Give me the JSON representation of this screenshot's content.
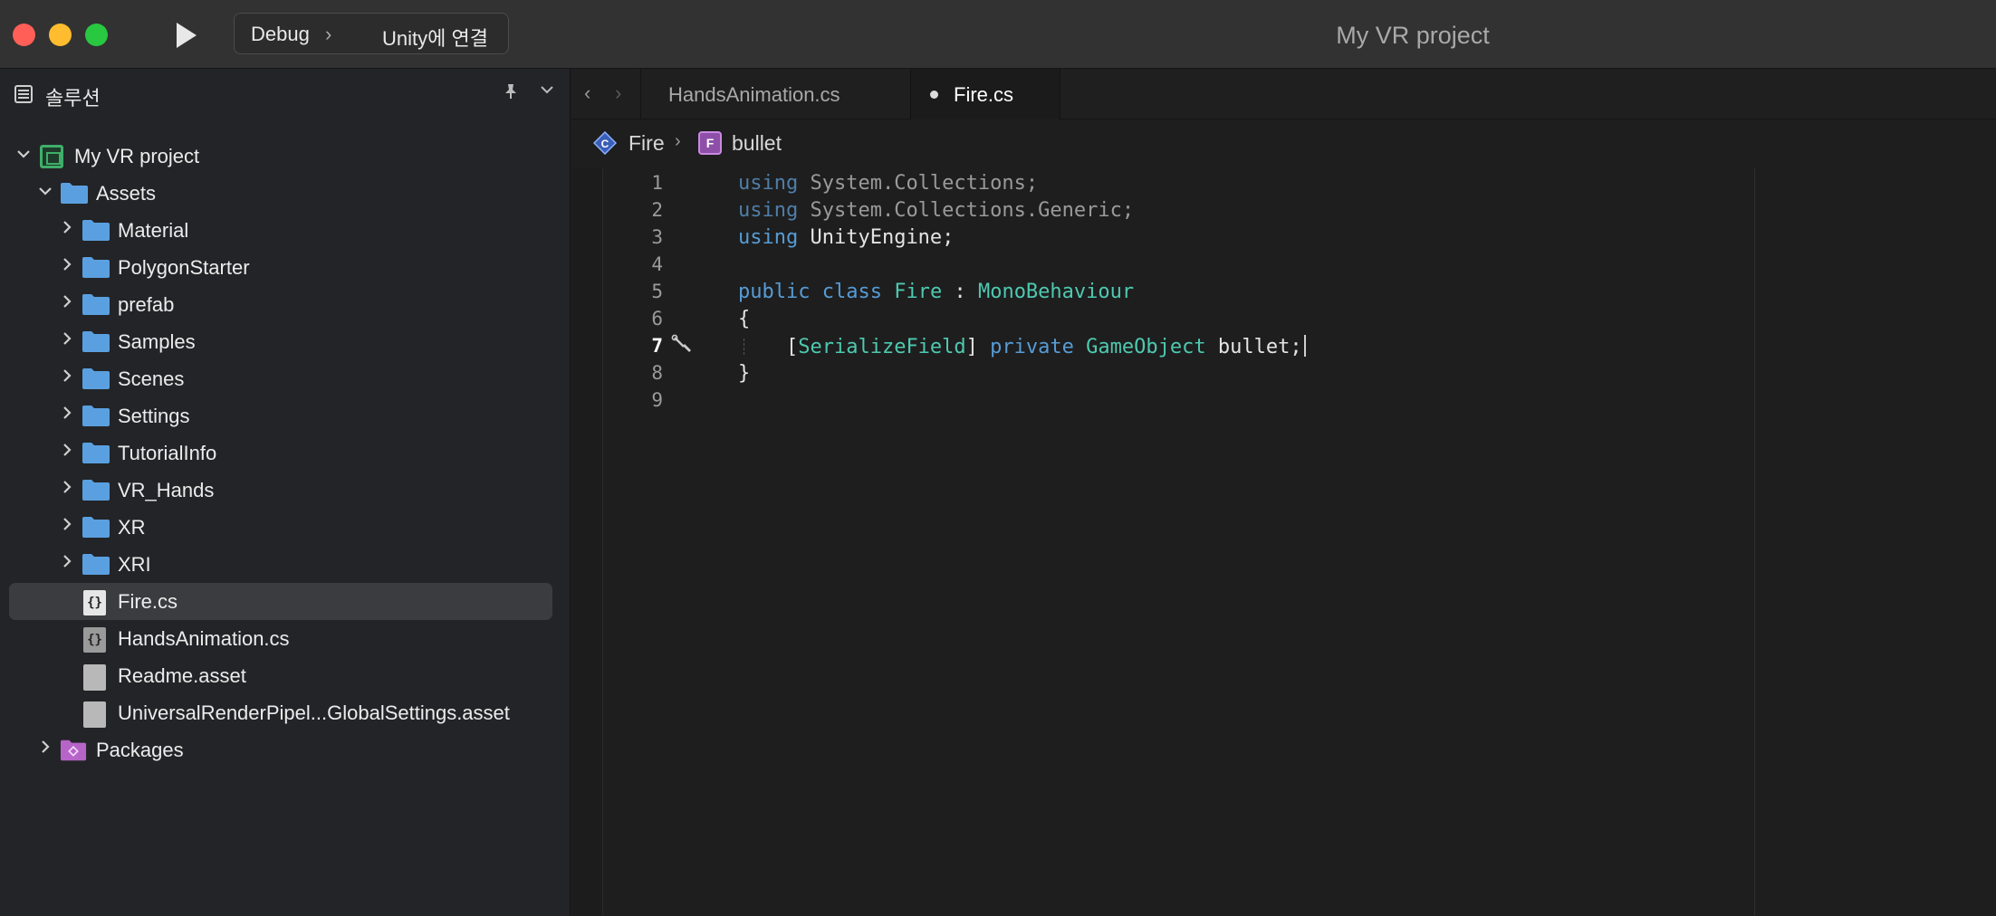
{
  "titlebar": {
    "window_title": "My VR project",
    "config": {
      "scheme": "Debug",
      "separator": "›",
      "target": "Unity에 연결"
    }
  },
  "sidebar": {
    "title": "솔루션",
    "pin_glyph": "📌",
    "menu_glyph": "⌄",
    "tree": {
      "project": "My VR project",
      "assets": "Assets",
      "folders": [
        "Material",
        "PolygonStarter",
        "prefab",
        "Samples",
        "Scenes",
        "Settings",
        "TutorialInfo",
        "VR_Hands",
        "XR",
        "XRI"
      ],
      "files": [
        "Fire.cs",
        "HandsAnimation.cs",
        "Readme.asset",
        "UniversalRenderPipel...GlobalSettings.asset"
      ],
      "packages": "Packages",
      "selected_file": "Fire.cs"
    },
    "icon_colors": {
      "folder": "#5aa0e0",
      "project": "#3fae6a",
      "packages": "#b764c9"
    }
  },
  "editor": {
    "tabs": [
      {
        "label": "HandsAnimation.cs",
        "active": false
      },
      {
        "label": "Fire.cs",
        "active": true,
        "modified": true
      }
    ],
    "nav": {
      "back": "‹",
      "forward": "›"
    },
    "breadcrumb": {
      "class_name": "Fire",
      "separator": "›",
      "member_badge": "F",
      "member_name": "bullet"
    },
    "current_line": 7,
    "line_numbers": [
      "1",
      "2",
      "3",
      "4",
      "5",
      "6",
      "7",
      "8",
      "9"
    ],
    "code": {
      "l1_kw": "using",
      "l1_rest": " System.Collections;",
      "l2_kw": "using",
      "l2_rest": " System.Collections.Generic;",
      "l3_kw": "using",
      "l3_rest": " UnityEngine;",
      "l5_public": "public",
      "l5_class": "class",
      "l5_name": "Fire",
      "l5_colon": " : ",
      "l5_base": "MonoBehaviour",
      "l6": "{",
      "l7_open": "[",
      "l7_attr": "SerializeField",
      "l7_close": "]",
      "l7_private": "private",
      "l7_type": "GameObject",
      "l7_field": "bullet;",
      "l8": "}"
    },
    "syntax_colors": {
      "keyword": "#569cd6",
      "type": "#4ec9b0",
      "text": "#e4e4e4"
    }
  }
}
